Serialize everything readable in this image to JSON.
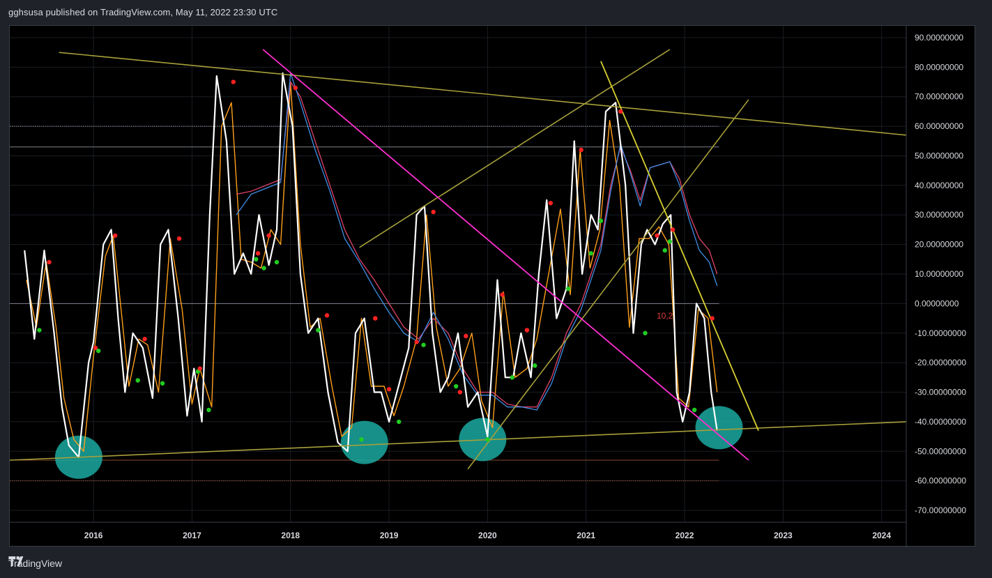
{
  "header": {
    "text": "gghsusa published on TradingView.com, May 11, 2022 23:30 UTC"
  },
  "footer": {
    "brand": "TradingView",
    "logo_icon": "tradingview-logo-icon"
  },
  "colors": {
    "background": "#000000",
    "oscillator": "#ffffff",
    "signal": "#ff9f1a",
    "ma_red": "#e0436b",
    "ma_blue": "#3f8fe6",
    "trendline_olive": "#a8a03a",
    "trendline_yellow": "#d8d030",
    "trendline_magenta": "#ff2fd0",
    "ellipse": "#1aa9a0",
    "dot_red": "#ff2222",
    "dot_green": "#22cc22"
  },
  "annotation": {
    "text": "10,2"
  },
  "chart_data": {
    "type": "line",
    "x_ticks": [
      "2016",
      "2017",
      "2018",
      "2019",
      "2020",
      "2021",
      "2022",
      "2023",
      "2024"
    ],
    "y_ticks": [
      "90.00000000",
      "80.00000000",
      "70.00000000",
      "60.00000000",
      "50.00000000",
      "40.00000000",
      "30.00000000",
      "20.00000000",
      "10.00000000",
      "0.00000000",
      "-10.00000000",
      "-20.00000000",
      "-30.00000000",
      "-40.00000000",
      "-50.00000000",
      "-60.00000000",
      "-70.00000000"
    ],
    "ylim": [
      -74,
      94
    ],
    "xlim": [
      2015.15,
      2024.25
    ],
    "grid": true,
    "horizontal_levels": [
      {
        "y": 60,
        "style": "dotted",
        "color": "#9aa0a8"
      },
      {
        "y": 53,
        "style": "solid",
        "color": "#7d828a"
      },
      {
        "y": 0,
        "style": "solid",
        "color": "#7d828a"
      },
      {
        "y": -53,
        "style": "solid",
        "color": "#8a4a2a"
      },
      {
        "y": -60,
        "style": "dotted",
        "color": "#a05a3a"
      }
    ],
    "series": [
      {
        "key": "oscillator",
        "x": [
          2015.3,
          2015.4,
          2015.5,
          2015.6,
          2015.68,
          2015.75,
          2015.85,
          2015.95,
          2016.0,
          2016.1,
          2016.18,
          2016.25,
          2016.32,
          2016.4,
          2016.5,
          2016.6,
          2016.68,
          2016.76,
          2016.86,
          2016.95,
          2017.02,
          2017.1,
          2017.18,
          2017.25,
          2017.35,
          2017.43,
          2017.52,
          2017.6,
          2017.68,
          2017.78,
          2017.86,
          2017.92,
          2018.02,
          2018.1,
          2018.18,
          2018.28,
          2018.38,
          2018.48,
          2018.58,
          2018.66,
          2018.75,
          2018.85,
          2018.92,
          2019.0,
          2019.08,
          2019.2,
          2019.28,
          2019.36,
          2019.44,
          2019.52,
          2019.6,
          2019.7,
          2019.8,
          2019.9,
          2020.0,
          2020.1,
          2020.18,
          2020.26,
          2020.34,
          2020.44,
          2020.52,
          2020.6,
          2020.7,
          2020.8,
          2020.88,
          2020.96,
          2021.05,
          2021.12,
          2021.2,
          2021.3,
          2021.4,
          2021.48,
          2021.56,
          2021.62,
          2021.7,
          2021.78,
          2021.86,
          2021.92,
          2021.98,
          2022.05,
          2022.12,
          2022.2,
          2022.27,
          2022.33
        ],
        "y": [
          18,
          -12,
          18,
          -10,
          -35,
          -48,
          -52,
          -20,
          -13,
          20,
          25,
          -5,
          -30,
          -10,
          -15,
          -32,
          20,
          25,
          -5,
          -38,
          -22,
          -40,
          30,
          77,
          55,
          10,
          17,
          10,
          30,
          13,
          25,
          78,
          60,
          10,
          -10,
          -5,
          -30,
          -47,
          -50,
          -10,
          -5,
          -30,
          -30,
          -40,
          -30,
          -15,
          30,
          33,
          -10,
          -30,
          -25,
          -10,
          -35,
          -30,
          -45,
          8,
          -25,
          -25,
          -10,
          -25,
          10,
          35,
          -5,
          5,
          55,
          10,
          30,
          25,
          65,
          68,
          40,
          -10,
          20,
          25,
          20,
          27,
          30,
          -30,
          -40,
          -30,
          0,
          -5,
          -30,
          -43
        ]
      },
      {
        "key": "signal",
        "x": [
          2015.32,
          2015.42,
          2015.52,
          2015.62,
          2015.7,
          2015.8,
          2015.9,
          2016.0,
          2016.12,
          2016.2,
          2016.28,
          2016.36,
          2016.46,
          2016.55,
          2016.66,
          2016.78,
          2016.9,
          2017.0,
          2017.08,
          2017.2,
          2017.3,
          2017.4,
          2017.5,
          2017.6,
          2017.7,
          2017.8,
          2017.9,
          2018.0,
          2018.1,
          2018.2,
          2018.3,
          2018.42,
          2018.52,
          2018.62,
          2018.72,
          2018.82,
          2018.95,
          2019.05,
          2019.15,
          2019.28,
          2019.38,
          2019.48,
          2019.6,
          2019.72,
          2019.84,
          2019.94,
          2020.05,
          2020.16,
          2020.28,
          2020.4,
          2020.5,
          2020.62,
          2020.74,
          2020.84,
          2020.94,
          2021.04,
          2021.14,
          2021.24,
          2021.34,
          2021.44,
          2021.54,
          2021.64,
          2021.74,
          2021.84,
          2021.94,
          2022.04,
          2022.14,
          2022.24,
          2022.33
        ],
        "y": [
          8,
          -8,
          14,
          -8,
          -32,
          -46,
          -50,
          -18,
          16,
          23,
          -2,
          -28,
          -12,
          -14,
          -30,
          22,
          -2,
          -34,
          -22,
          -35,
          60,
          68,
          15,
          14,
          12,
          25,
          20,
          75,
          20,
          -8,
          -5,
          -28,
          -45,
          -42,
          -5,
          -28,
          -28,
          -38,
          -28,
          -12,
          30,
          -8,
          -28,
          -22,
          -10,
          -33,
          -42,
          4,
          -25,
          -22,
          -12,
          10,
          32,
          3,
          52,
          12,
          25,
          62,
          40,
          -8,
          22,
          22,
          26,
          20,
          -32,
          -35,
          -2,
          -5,
          -30
        ]
      },
      {
        "key": "ma_red",
        "x": [
          2017.45,
          2017.6,
          2017.75,
          2017.9,
          2018.0,
          2018.1,
          2018.25,
          2018.4,
          2018.55,
          2018.7,
          2018.85,
          2019.0,
          2019.15,
          2019.3,
          2019.45,
          2019.6,
          2019.75,
          2019.9,
          2020.05,
          2020.2,
          2020.35,
          2020.5,
          2020.65,
          2020.8,
          2020.95,
          2021.05,
          2021.15,
          2021.25,
          2021.35,
          2021.45,
          2021.55,
          2021.65,
          2021.75,
          2021.85,
          2021.95,
          2022.05,
          2022.15,
          2022.25,
          2022.33
        ],
        "y": [
          37,
          38,
          40,
          42,
          75,
          70,
          55,
          40,
          25,
          15,
          8,
          0,
          -8,
          -12,
          -5,
          -10,
          -22,
          -30,
          -30,
          -34,
          -35,
          -35,
          -25,
          -10,
          0,
          10,
          20,
          40,
          53,
          45,
          35,
          46,
          47,
          48,
          42,
          30,
          22,
          18,
          10
        ]
      },
      {
        "key": "ma_blue",
        "x": [
          2017.45,
          2017.6,
          2017.75,
          2017.9,
          2018.0,
          2018.1,
          2018.25,
          2018.4,
          2018.55,
          2018.7,
          2018.85,
          2019.0,
          2019.15,
          2019.3,
          2019.45,
          2019.6,
          2019.75,
          2019.9,
          2020.05,
          2020.2,
          2020.35,
          2020.5,
          2020.65,
          2020.8,
          2020.95,
          2021.05,
          2021.15,
          2021.25,
          2021.35,
          2021.45,
          2021.55,
          2021.65,
          2021.75,
          2021.85,
          2021.95,
          2022.05,
          2022.15,
          2022.25,
          2022.33
        ],
        "y": [
          30,
          37,
          39,
          41,
          78,
          68,
          52,
          38,
          22,
          14,
          5,
          -3,
          -10,
          -13,
          -3,
          -12,
          -24,
          -31,
          -31,
          -35,
          -35,
          -36,
          -27,
          -12,
          -2,
          8,
          18,
          38,
          54,
          44,
          33,
          46,
          47,
          48,
          40,
          28,
          18,
          14,
          6
        ]
      }
    ],
    "dots": [
      {
        "x": 2015.55,
        "y": 14,
        "c": "red"
      },
      {
        "x": 2015.45,
        "y": -9,
        "c": "green"
      },
      {
        "x": 2016.02,
        "y": -15,
        "c": "red"
      },
      {
        "x": 2016.05,
        "y": -16,
        "c": "green"
      },
      {
        "x": 2016.22,
        "y": 23,
        "c": "red"
      },
      {
        "x": 2016.45,
        "y": -26,
        "c": "green"
      },
      {
        "x": 2016.52,
        "y": -12,
        "c": "red"
      },
      {
        "x": 2016.7,
        "y": -27,
        "c": "green"
      },
      {
        "x": 2016.87,
        "y": 22,
        "c": "red"
      },
      {
        "x": 2017.06,
        "y": -23,
        "c": "green"
      },
      {
        "x": 2017.08,
        "y": -22,
        "c": "red"
      },
      {
        "x": 2017.17,
        "y": -36,
        "c": "green"
      },
      {
        "x": 2017.42,
        "y": 75,
        "c": "red"
      },
      {
        "x": 2017.65,
        "y": 15,
        "c": "green"
      },
      {
        "x": 2017.67,
        "y": 17,
        "c": "red"
      },
      {
        "x": 2017.73,
        "y": 12,
        "c": "green"
      },
      {
        "x": 2017.78,
        "y": 23,
        "c": "red"
      },
      {
        "x": 2017.86,
        "y": 14,
        "c": "green"
      },
      {
        "x": 2018.05,
        "y": 73,
        "c": "red"
      },
      {
        "x": 2018.28,
        "y": -9,
        "c": "green"
      },
      {
        "x": 2018.37,
        "y": -4,
        "c": "red"
      },
      {
        "x": 2018.72,
        "y": -46,
        "c": "green"
      },
      {
        "x": 2018.86,
        "y": -5,
        "c": "red"
      },
      {
        "x": 2019.0,
        "y": -29,
        "c": "red"
      },
      {
        "x": 2019.1,
        "y": -40,
        "c": "green"
      },
      {
        "x": 2019.28,
        "y": -13,
        "c": "red"
      },
      {
        "x": 2019.35,
        "y": -14,
        "c": "green"
      },
      {
        "x": 2019.45,
        "y": 31,
        "c": "red"
      },
      {
        "x": 2019.68,
        "y": -28,
        "c": "green"
      },
      {
        "x": 2019.72,
        "y": -30,
        "c": "red"
      },
      {
        "x": 2019.78,
        "y": -11,
        "c": "red"
      },
      {
        "x": 2020.0,
        "y": -46,
        "c": "green"
      },
      {
        "x": 2020.15,
        "y": 3,
        "c": "red"
      },
      {
        "x": 2020.25,
        "y": -25,
        "c": "green"
      },
      {
        "x": 2020.4,
        "y": -9,
        "c": "red"
      },
      {
        "x": 2020.48,
        "y": -21,
        "c": "green"
      },
      {
        "x": 2020.64,
        "y": 34,
        "c": "red"
      },
      {
        "x": 2020.82,
        "y": 5,
        "c": "green"
      },
      {
        "x": 2020.95,
        "y": 52,
        "c": "red"
      },
      {
        "x": 2021.05,
        "y": 17,
        "c": "green"
      },
      {
        "x": 2021.15,
        "y": 28,
        "c": "green"
      },
      {
        "x": 2021.35,
        "y": 65,
        "c": "red"
      },
      {
        "x": 2021.6,
        "y": -10,
        "c": "green"
      },
      {
        "x": 2021.72,
        "y": 23,
        "c": "red"
      },
      {
        "x": 2021.8,
        "y": 18,
        "c": "green"
      },
      {
        "x": 2021.85,
        "y": 21,
        "c": "green"
      },
      {
        "x": 2021.88,
        "y": 25,
        "c": "red"
      },
      {
        "x": 2022.1,
        "y": -36,
        "c": "green"
      },
      {
        "x": 2022.28,
        "y": -5,
        "c": "red"
      }
    ],
    "trendlines": [
      {
        "x1": 2015.65,
        "y1": 85,
        "x2": 2024.25,
        "y2": 57,
        "color": "olive"
      },
      {
        "x1": 2015.15,
        "y1": -53,
        "x2": 2024.25,
        "y2": -40,
        "color": "olive"
      },
      {
        "x1": 2018.7,
        "y1": 19,
        "x2": 2021.85,
        "y2": 86,
        "color": "olive"
      },
      {
        "x1": 2019.8,
        "y1": -56,
        "x2": 2022.65,
        "y2": 69,
        "color": "olive"
      },
      {
        "x1": 2021.15,
        "y1": 82,
        "x2": 2022.75,
        "y2": -43,
        "color": "yellow"
      },
      {
        "x1": 2017.72,
        "y1": 86,
        "x2": 2022.65,
        "y2": -53,
        "color": "magenta"
      }
    ],
    "ellipses": [
      {
        "x": 2015.85,
        "y": -52
      },
      {
        "x": 2018.75,
        "y": -47
      },
      {
        "x": 2019.95,
        "y": -46
      },
      {
        "x": 2022.35,
        "y": -42
      }
    ]
  }
}
